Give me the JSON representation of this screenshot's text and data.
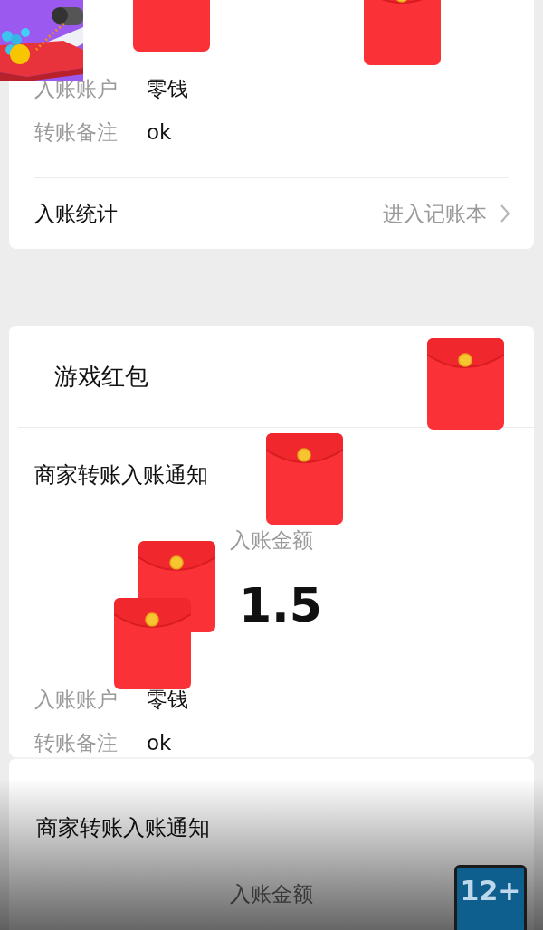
{
  "record_card": {
    "rows": [
      {
        "label": "入账账户",
        "value": "零钱"
      },
      {
        "label": "转账备注",
        "value": "ok"
      }
    ],
    "stats": {
      "label": "入账统计",
      "link": "进入记账本"
    }
  },
  "game_card": {
    "header": "游戏红包",
    "title": "商家转账入账通知",
    "amount_label": "入账金额",
    "amount": "1.5",
    "rows": [
      {
        "label": "入账账户",
        "value": "零钱"
      },
      {
        "label": "转账备注",
        "value": "ok"
      }
    ]
  },
  "next_card": {
    "title": "商家转账入账通知",
    "amount_label": "入账金额"
  },
  "rating_badge": {
    "text": "12+"
  }
}
